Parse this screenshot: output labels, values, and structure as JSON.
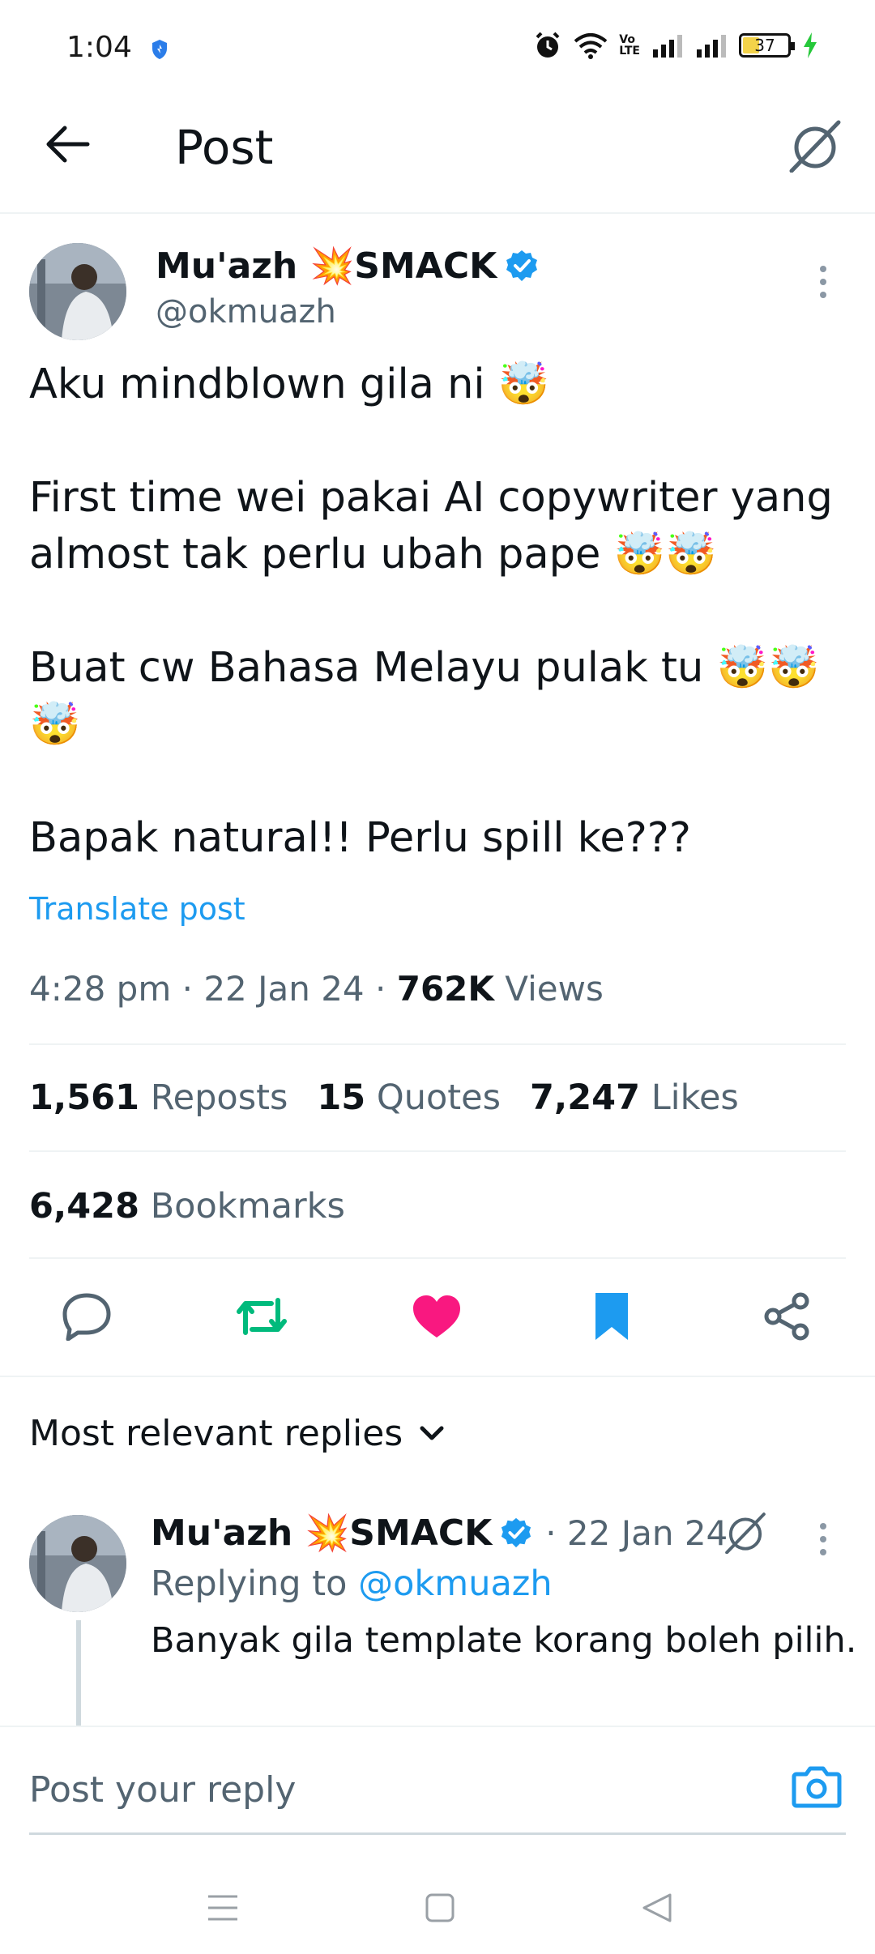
{
  "status_bar": {
    "time": "1:04",
    "volte_top": "Vo",
    "volte_bottom": "LTE",
    "battery": "37"
  },
  "header": {
    "title": "Post"
  },
  "post": {
    "author_name": "Mu'azh 💥SMACK",
    "author_handle": "@okmuazh",
    "text": "Aku mindblown gila ni 🤯\n\nFirst time wei pakai AI copywriter yang almost tak perlu ubah pape 🤯🤯\n\nBuat cw Bahasa Melayu pulak tu 🤯🤯🤯\n\nBapak natural!! Perlu spill ke???",
    "translate_label": "Translate post",
    "time": "4:28 pm",
    "date": "22 Jan 24",
    "views_count": "762K",
    "views_label": "Views",
    "reposts_count": "1,561",
    "reposts_label": "Reposts",
    "quotes_count": "15",
    "quotes_label": "Quotes",
    "likes_count": "7,247",
    "likes_label": "Likes",
    "bookmarks_count": "6,428",
    "bookmarks_label": "Bookmarks"
  },
  "replies": {
    "sort_label": "Most relevant replies",
    "items": [
      {
        "author_name": "Mu'azh 💥SMACK",
        "date": "· 22 Jan 24",
        "replying_prefix": "Replying to",
        "replying_handle": "@okmuazh",
        "text": "Banyak gila template korang boleh pilih."
      }
    ]
  },
  "composer": {
    "placeholder": "Post your reply"
  },
  "colors": {
    "accent": "#1d9bf0",
    "like": "#f91880",
    "repost": "#00ba7c",
    "muted": "#536471",
    "verified": "#1d9bf0"
  }
}
